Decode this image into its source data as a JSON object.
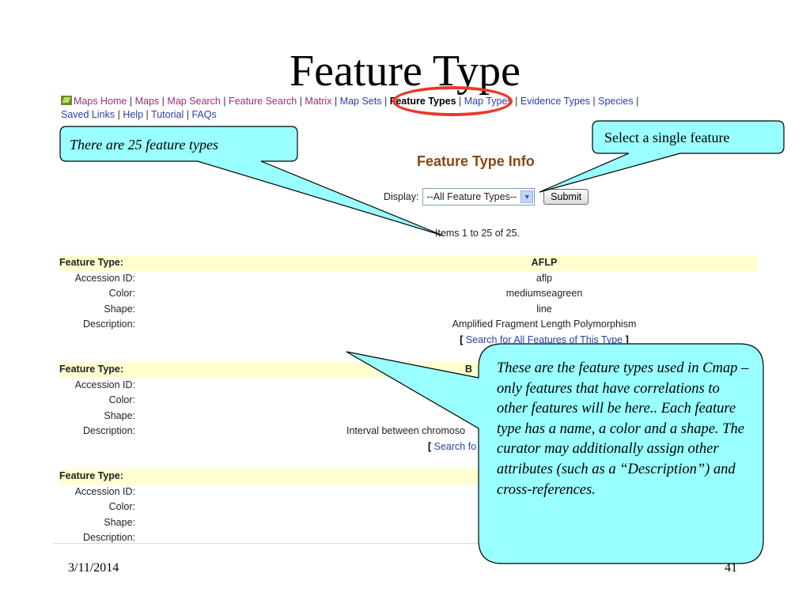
{
  "slide": {
    "title": "Feature Type",
    "date": "3/11/2014",
    "page_number": "41"
  },
  "nav": {
    "row1": [
      {
        "label": "Maps Home",
        "style": "maps"
      },
      {
        "label": "Maps",
        "style": "maps"
      },
      {
        "label": "Map Search",
        "style": "maps"
      },
      {
        "label": "Feature Search",
        "style": "maps"
      },
      {
        "label": "Matrix",
        "style": "maps"
      },
      {
        "label": "Map Sets",
        "style": "link"
      },
      {
        "label": "Feature Types",
        "style": "current"
      },
      {
        "label": "Map Types",
        "style": "link"
      },
      {
        "label": "Evidence Types",
        "style": "link"
      },
      {
        "label": "Species",
        "style": "link"
      }
    ],
    "row2": [
      {
        "label": "Saved Links",
        "style": "link"
      },
      {
        "label": "Help",
        "style": "link"
      },
      {
        "label": "Tutorial",
        "style": "link"
      },
      {
        "label": "FAQs",
        "style": "link"
      }
    ],
    "separator": "|"
  },
  "main": {
    "heading": "Feature Type Info",
    "display_label": "Display:",
    "display_selected": "--All Feature Types--",
    "submit_label": "Submit",
    "items_count": "Items 1 to 25 of 25."
  },
  "labels": {
    "feature_type": "Feature Type:",
    "accession_id": "Accession ID:",
    "color": "Color:",
    "shape": "Shape:",
    "description": "Description:"
  },
  "feature_types": [
    {
      "name": "AFLP",
      "accession_id": "aflp",
      "color": "mediumseagreen",
      "shape": "line",
      "description": "Amplified Fragment Length Polymorphism",
      "search_link": "Search for All Features of This Type"
    },
    {
      "name": "B",
      "accession_id": "",
      "color": "",
      "shape": "",
      "description": "Interval between chromoso",
      "search_link": "Search fo"
    },
    {
      "name": "",
      "accession_id": "",
      "color": "",
      "shape": "",
      "description": "",
      "search_link": ""
    }
  ],
  "callouts": {
    "count_note": "There are 25 feature types",
    "select_note": "Select a single feature",
    "explanation": "These are the feature types used in Cmap – only features that have correlations to other features will be here..  Each feature type has a name, a color and a shape.  The curator may additionally assign other attributes (such as a “Description”) and cross-references."
  },
  "colors": {
    "callout_fill": "#99ffff",
    "highlight_ring": "#e8392a",
    "header_row_bg": "#ffffd0",
    "heading_color": "#8b4513"
  }
}
